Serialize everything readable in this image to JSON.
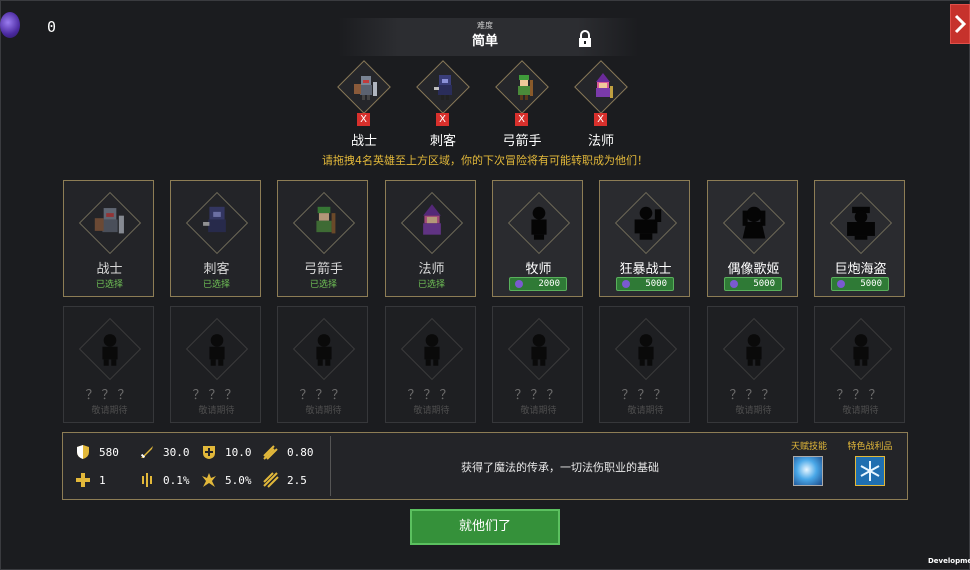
{
  "currency": {
    "icon": "purple-gem-icon",
    "count": "0"
  },
  "difficulty": {
    "label": "难度",
    "value": "简单"
  },
  "selected_heroes": [
    {
      "name": "战士",
      "remove": "X"
    },
    {
      "name": "刺客",
      "remove": "X"
    },
    {
      "name": "弓箭手",
      "remove": "X"
    },
    {
      "name": "法师",
      "remove": "X"
    }
  ],
  "hint": "请拖拽4名英雄至上方区域，你的下次冒险将有可能转职成为他们！",
  "heroes_row1": [
    {
      "name": "战士",
      "status": "已选择"
    },
    {
      "name": "刺客",
      "status": "已选择"
    },
    {
      "name": "弓箭手",
      "status": "已选择"
    },
    {
      "name": "法师",
      "status": "已选择"
    },
    {
      "name": "牧师",
      "price": "2000"
    },
    {
      "name": "狂暴战士",
      "price": "5000"
    },
    {
      "name": "偶像歌姬",
      "price": "5000"
    },
    {
      "name": "巨炮海盗",
      "price": "5000"
    }
  ],
  "heroes_row2": [
    {
      "name": "？？？",
      "status": "敬请期待"
    },
    {
      "name": "？？？",
      "status": "敬请期待"
    },
    {
      "name": "？？？",
      "status": "敬请期待"
    },
    {
      "name": "？？？",
      "status": "敬请期待"
    },
    {
      "name": "？？？",
      "status": "敬请期待"
    },
    {
      "name": "？？？",
      "status": "敬请期待"
    },
    {
      "name": "？？？",
      "status": "敬请期待"
    },
    {
      "name": "？？？",
      "status": "敬请期待"
    }
  ],
  "stats": {
    "hp": "580",
    "attack": "30.0",
    "defense": "10.0",
    "attack_speed": "0.80",
    "regen": "1",
    "crit_chance": "0.1%",
    "crit_damage": "5.0%",
    "range": "2.5"
  },
  "description": "获得了魔法的传承，一切法伤职业的基础",
  "talent_label": "天赋技能",
  "loot_label": "特色战利品",
  "confirm_label": "就他们了",
  "dev_label": "Development",
  "colors": {
    "accent_gold": "#e2b83a",
    "confirm_green": "#35913a",
    "close_red": "#c6322c"
  }
}
